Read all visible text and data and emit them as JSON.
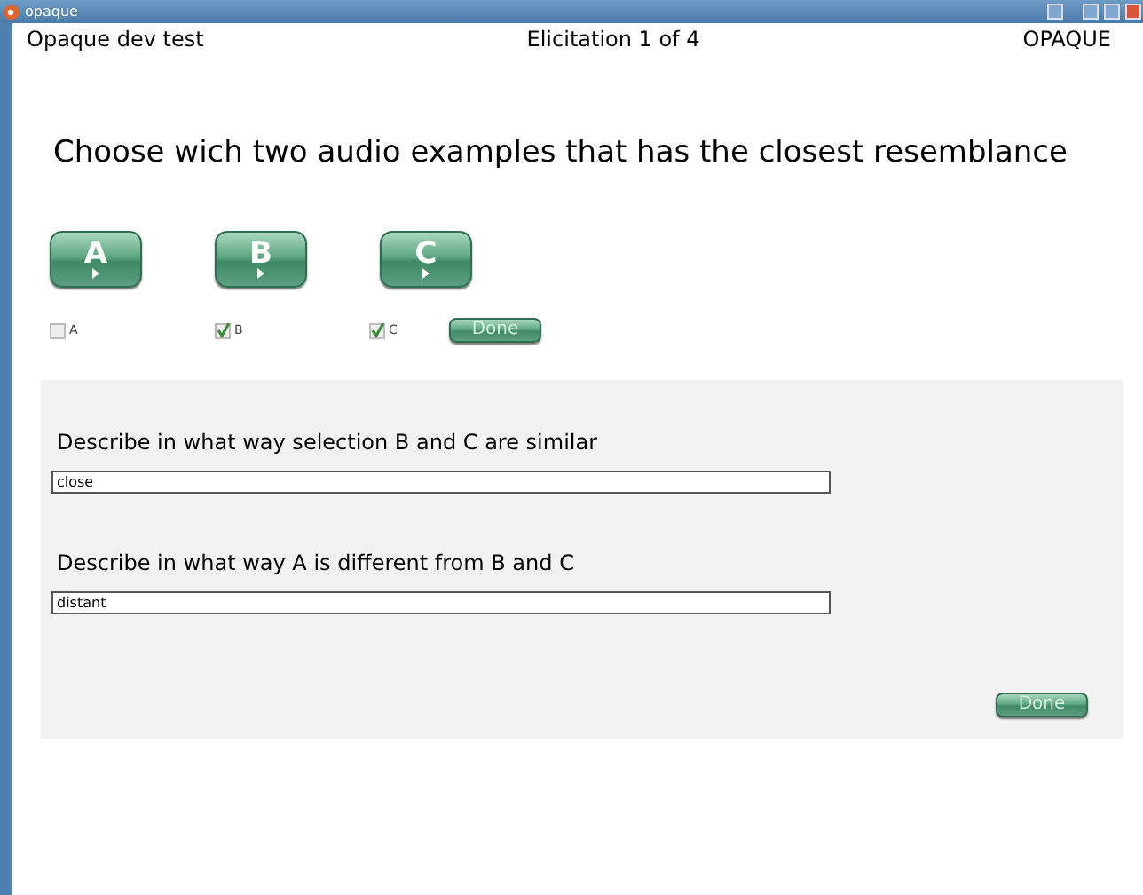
{
  "window": {
    "title": "opaque"
  },
  "header": {
    "left": "Opaque dev test",
    "center": "Elicitation 1 of 4",
    "right": "OPAQUE"
  },
  "question": "Choose wich two audio examples that has the closest resemblance",
  "sound_buttons": [
    "A",
    "B",
    "C"
  ],
  "choices": [
    {
      "label": "A",
      "checked": false
    },
    {
      "label": "B",
      "checked": true
    },
    {
      "label": "C",
      "checked": true
    }
  ],
  "choice_done": "Done",
  "panel": {
    "prompts": [
      {
        "label": "Describe in what way selection B and C are similar",
        "value": "close"
      },
      {
        "label": "Describe in what way A is different from B and C",
        "value": "distant"
      }
    ],
    "done": "Done"
  }
}
